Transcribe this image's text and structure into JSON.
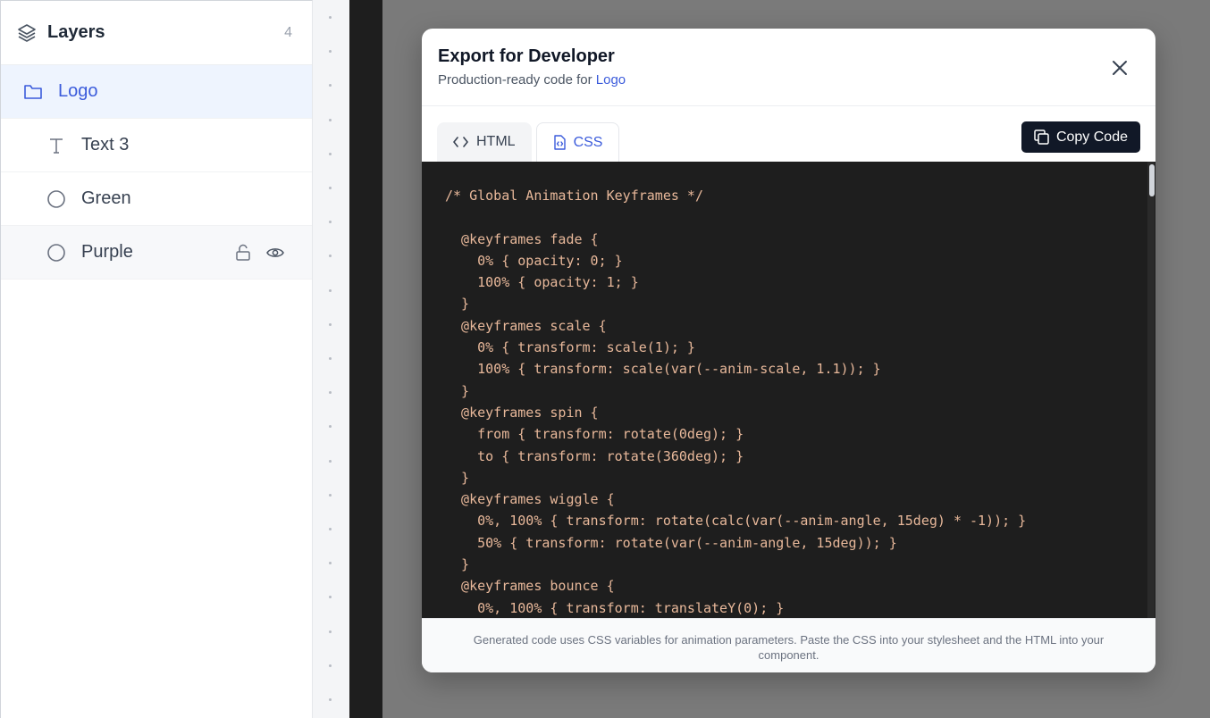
{
  "layers": {
    "title": "Layers",
    "count": "4",
    "items": [
      {
        "label": "Logo",
        "icon": "folder-icon",
        "selected": true
      },
      {
        "label": "Text 3",
        "icon": "text-icon"
      },
      {
        "label": "Green",
        "icon": "circle-icon"
      },
      {
        "label": "Purple",
        "icon": "circle-icon",
        "hovered": true
      }
    ]
  },
  "modal": {
    "title": "Export for Developer",
    "subtitle_prefix": "Production-ready code for ",
    "subtitle_link": "Logo",
    "tabs": [
      {
        "label": "HTML",
        "icon": "code-brackets-icon"
      },
      {
        "label": "CSS",
        "icon": "file-code-icon",
        "active": true
      }
    ],
    "copy_label": "Copy Code",
    "code": "/* Global Animation Keyframes */\n\n  @keyframes fade {\n    0% { opacity: 0; }\n    100% { opacity: 1; }\n  }\n  @keyframes scale {\n    0% { transform: scale(1); }\n    100% { transform: scale(var(--anim-scale, 1.1)); }\n  }\n  @keyframes spin {\n    from { transform: rotate(0deg); }\n    to { transform: rotate(360deg); }\n  }\n  @keyframes wiggle {\n    0%, 100% { transform: rotate(calc(var(--anim-angle, 15deg) * -1)); }\n    50% { transform: rotate(var(--anim-angle, 15deg)); }\n  }\n  @keyframes bounce {\n    0%, 100% { transform: translateY(0); }",
    "footer": "Generated code uses CSS variables for animation parameters. Paste the CSS into your stylesheet and the HTML into your component."
  },
  "colors": {
    "accent": "#3b5bdb",
    "code_bg": "#1e1e1e",
    "code_text": "#e8b89a",
    "overlay": "#7a7a7a"
  }
}
